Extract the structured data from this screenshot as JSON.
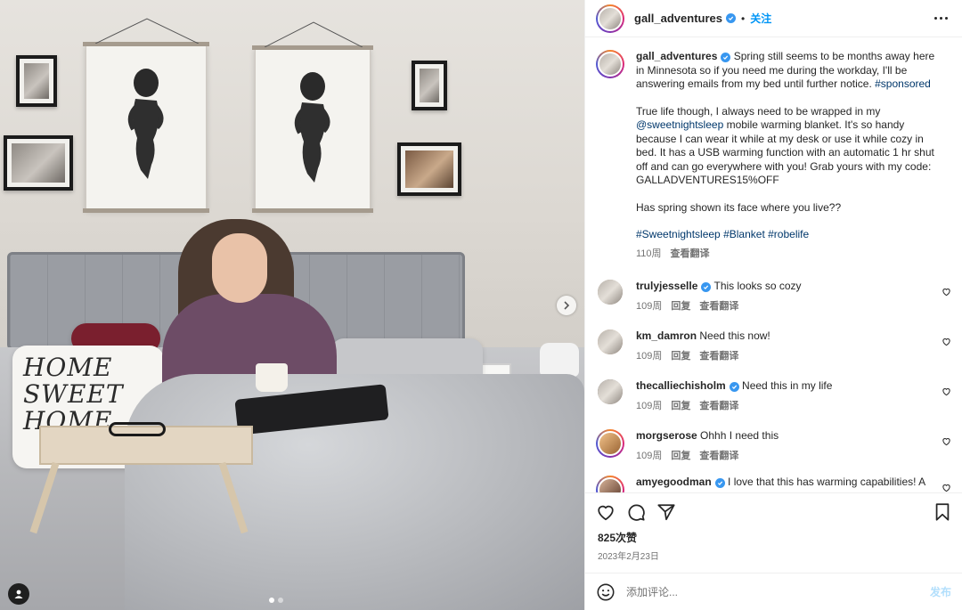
{
  "post": {
    "author": "gall_adventures",
    "follow_label": "关注",
    "separator": "•",
    "caption": {
      "text_1": "Spring still seems to be months away here in Minnesota so if you need me during the workday, I'll be answering emails from my bed until further notice. ",
      "tag_sponsored": "#sponsored",
      "text_2": "True life though, I always need to be wrapped in my ",
      "mention": "@sweetnightsleep",
      "text_3": " mobile warming blanket. It's so handy because I can wear it while at my desk or use it while cozy in bed. It has a USB warming function with an automatic 1 hr shut off and can go everywhere with you! Grab yours with my code: GALLADVENTURES15%OFF",
      "text_4": "Has spring shown its face where you live??",
      "hashtag_1": "#Sweetnightsleep",
      "hashtag_2": "#Blanket",
      "hashtag_3": "#robelife",
      "age": "110周",
      "translate": "查看翻译"
    },
    "likes": "825次赞",
    "date": "2023年2月23日"
  },
  "photo": {
    "pillow_text": [
      "HOME",
      "SWEET",
      "HOME"
    ]
  },
  "comments": [
    {
      "user": "trulyjesselle",
      "verified": true,
      "text": "This looks so cozy",
      "age": "109周",
      "reply": "回复",
      "translate": "查看翻译"
    },
    {
      "user": "km_damron",
      "verified": false,
      "text": "Need this now!",
      "age": "109周",
      "reply": "回复",
      "translate": "查看翻译"
    },
    {
      "user": "thecalliechisholm",
      "verified": true,
      "text": "Need this in my life",
      "age": "109周",
      "reply": "回复",
      "translate": "查看翻译"
    },
    {
      "user": "morgserose",
      "verified": false,
      "text": "Ohhh I need this",
      "age": "109周",
      "reply": "回复",
      "translate": "查看翻译"
    },
    {
      "user": "amyegoodman",
      "verified": true,
      "text": "I love that this has warming capabilities! A",
      "age": "",
      "reply": "",
      "translate": ""
    }
  ],
  "comment_input": {
    "placeholder": "添加评论...",
    "post_label": "发布"
  },
  "colors": {
    "link": "#00376b",
    "follow": "#0095f6",
    "verified": "#3897f0",
    "muted": "#737373"
  },
  "icons": [
    "more-icon",
    "verified-icon",
    "heart-icon",
    "comment-icon",
    "share-icon",
    "bookmark-icon",
    "emoji-icon",
    "chevron-right-icon",
    "user-tag-icon"
  ]
}
